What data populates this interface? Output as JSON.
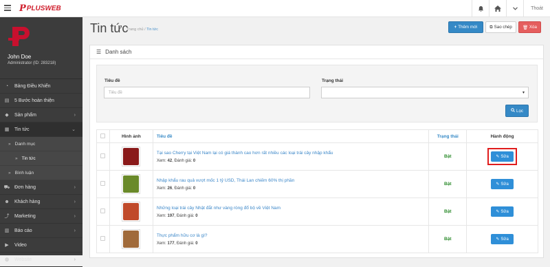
{
  "header": {
    "logo_text": "PLUSWEB",
    "logout_label": "Thoát",
    "icons": [
      "menu-icon",
      "bell-icon",
      "home-icon",
      "chevron-down-icon"
    ]
  },
  "profile": {
    "name": "John Doe",
    "role": "Administrator (ID: 283218)"
  },
  "sidebar": {
    "items": [
      {
        "label": "Bảng Điều Khiển",
        "icon": "dashboard-icon"
      },
      {
        "label": "5 Bước hoàn thiện",
        "icon": "book-icon"
      },
      {
        "label": "Sản phẩm",
        "icon": "tag-icon",
        "chevron": "›"
      },
      {
        "label": "Tin tức",
        "icon": "news-icon",
        "chevron": "⌄",
        "active": true
      },
      {
        "label": "Danh mục",
        "sub": true
      },
      {
        "label": "Tin tức",
        "sub": true,
        "current": true
      },
      {
        "label": "Bình luận",
        "sub": true
      },
      {
        "label": "Đơn hàng",
        "icon": "cart-icon",
        "chevron": "›"
      },
      {
        "label": "Khách hàng",
        "icon": "users-icon",
        "chevron": "›"
      },
      {
        "label": "Marketing",
        "icon": "share-icon",
        "chevron": "›"
      },
      {
        "label": "Báo cáo",
        "icon": "chart-icon",
        "chevron": "›"
      },
      {
        "label": "Video",
        "icon": "video-icon"
      },
      {
        "label": "Website",
        "icon": "globe-icon",
        "chevron": "›"
      }
    ]
  },
  "page": {
    "title": "Tin tức",
    "breadcrumb": [
      "Trang chủ",
      "Tin tức"
    ],
    "actions": {
      "add": "Thêm mới",
      "copy": "Sao chép",
      "delete": "Xóa"
    }
  },
  "panel": {
    "title": "Danh sách"
  },
  "filter": {
    "title_label": "Tiêu đề",
    "title_placeholder": "Tiêu đề",
    "status_label": "Trạng thái",
    "status_value": "",
    "submit": "Lọc"
  },
  "table": {
    "headers": [
      "",
      "Hình ảnh",
      "Tiêu đề",
      "Trạng thái",
      "Hành động"
    ],
    "rows": [
      {
        "title": "Tại sao Cherry tại Việt Nam lại có giá thành cao hơn rất nhiều các loại trái cây nhập khẩu",
        "views_label": "Xem:",
        "views": "42",
        "rating_label": "Đánh giá:",
        "rating": "0",
        "status": "Bật",
        "edit": "Sửa",
        "thumb_color": "#8a1a1a",
        "highlighted": true
      },
      {
        "title": "Nhập khẩu rau quả vượt mốc 1 tỷ USD, Thái Lan chiếm 60% thị phần",
        "views_label": "Xem:",
        "views": "26",
        "rating_label": "Đánh giá:",
        "rating": "0",
        "status": "Bật",
        "edit": "Sửa",
        "thumb_color": "#6a8a2a",
        "highlighted": false
      },
      {
        "title": "Những loại trái cây Nhật đắt như vàng ròng đổ bộ về Việt Nam",
        "views_label": "Xem:",
        "views": "197",
        "rating_label": "Đánh giá:",
        "rating": "0",
        "status": "Bật",
        "edit": "Sửa",
        "thumb_color": "#c04a2a",
        "highlighted": false
      },
      {
        "title": "Thực phẩm hữu cơ là gì?",
        "views_label": "Xem:",
        "views": "177",
        "rating_label": "Đánh giá:",
        "rating": "0",
        "status": "Bật",
        "edit": "Sửa",
        "thumb_color": "#a06a3a",
        "highlighted": false
      }
    ]
  }
}
